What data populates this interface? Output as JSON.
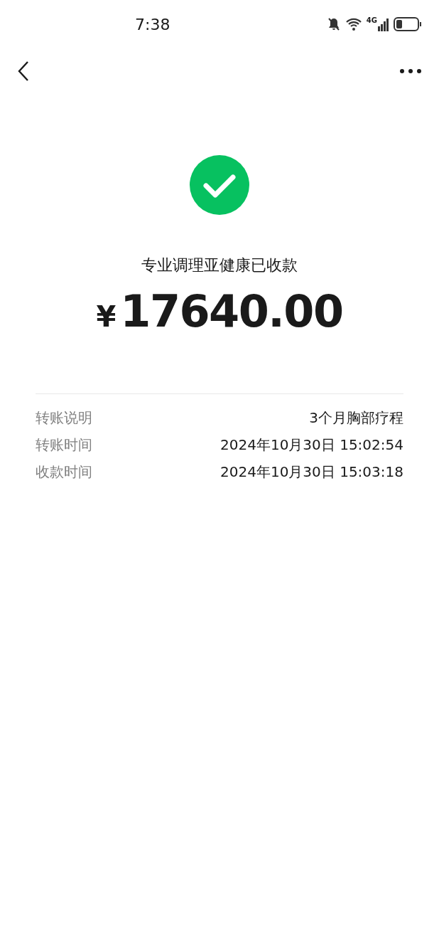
{
  "status_bar": {
    "time": "7:38",
    "network": "4G"
  },
  "result": {
    "title": "专业调理亚健康已收款",
    "currency": "¥",
    "amount": "17640.00"
  },
  "details": [
    {
      "label": "转账说明",
      "value": "3个月胸部疗程"
    },
    {
      "label": "转账时间",
      "value": "2024年10月30日 15:02:54"
    },
    {
      "label": "收款时间",
      "value": "2024年10月30日 15:03:18"
    }
  ]
}
